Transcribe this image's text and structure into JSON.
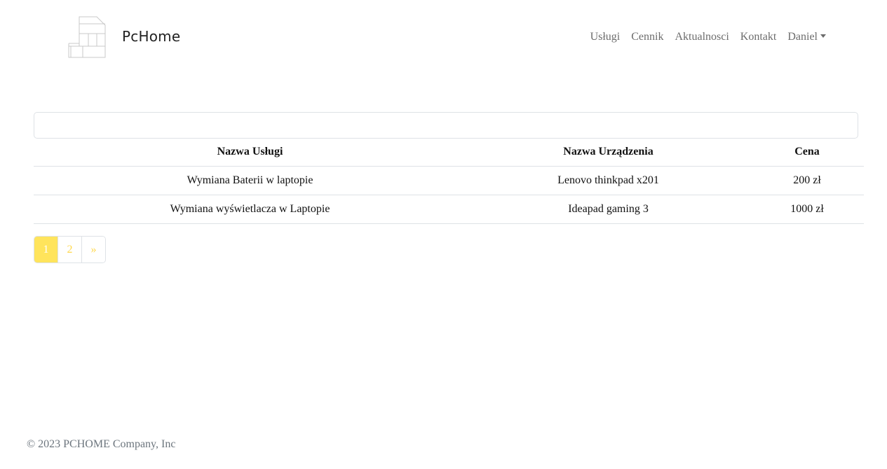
{
  "header": {
    "brand": "PcHome",
    "nav": [
      "Usługi",
      "Cennik",
      "Aktualnosci",
      "Kontakt"
    ],
    "user_menu": "Daniel",
    "logo_icon": "house-outline-icon",
    "caret_icon": "caret-down-icon"
  },
  "search": {
    "value": "",
    "placeholder": ""
  },
  "table": {
    "headers": [
      "Nazwa Usługi",
      "Nazwa Urządzenia",
      "Cena"
    ],
    "rows": [
      [
        "Wymiana Baterii w laptopie",
        "Lenovo thinkpad x201",
        "200 zł"
      ],
      [
        "Wymiana wyświetlacza w Laptopie",
        "Ideapad gaming 3",
        "1000 zł"
      ]
    ]
  },
  "pagination": {
    "pages": [
      "1",
      "2"
    ],
    "next": "»",
    "active_page": "1",
    "accent_color": "#ffe45c"
  },
  "footer": {
    "copyright": "© 2023 PCHOME Company, Inc"
  }
}
